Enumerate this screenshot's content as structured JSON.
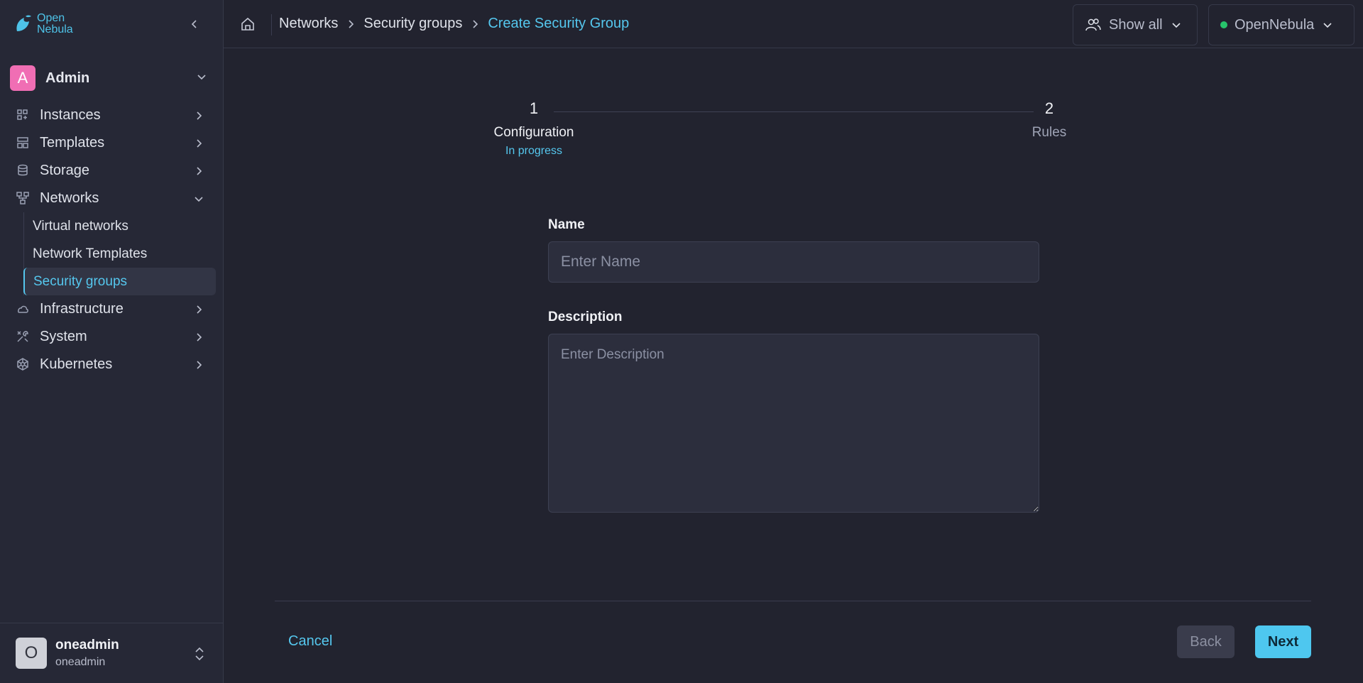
{
  "brand": {
    "logo_text_line1": "Open",
    "logo_text_line2": "Nebula",
    "accent": "#55c7ee"
  },
  "sidebar": {
    "group": {
      "avatar_letter": "A",
      "label": "Admin"
    },
    "items": [
      {
        "label": "Instances",
        "icon": "instances-icon"
      },
      {
        "label": "Templates",
        "icon": "templates-icon"
      },
      {
        "label": "Storage",
        "icon": "storage-icon"
      },
      {
        "label": "Networks",
        "icon": "networks-icon",
        "expanded": true,
        "children": [
          {
            "label": "Virtual networks"
          },
          {
            "label": "Network Templates"
          },
          {
            "label": "Security groups",
            "active": true
          }
        ]
      },
      {
        "label": "Infrastructure",
        "icon": "cloud-icon"
      },
      {
        "label": "System",
        "icon": "tools-icon"
      },
      {
        "label": "Kubernetes",
        "icon": "kubernetes-icon"
      }
    ],
    "user": {
      "avatar_letter": "O",
      "name": "oneadmin",
      "group": "oneadmin"
    }
  },
  "header": {
    "breadcrumb": [
      "Networks",
      "Security groups",
      "Create Security Group"
    ],
    "view_filter": "Show all",
    "zone": "OpenNebula",
    "zone_status_color": "#27c46b"
  },
  "stepper": {
    "steps": [
      {
        "number": "1",
        "label": "Configuration",
        "status": "In progress"
      },
      {
        "number": "2",
        "label": "Rules"
      }
    ]
  },
  "form": {
    "name_label": "Name",
    "name_placeholder": "Enter Name",
    "description_label": "Description",
    "description_placeholder": "Enter Description"
  },
  "actions": {
    "cancel": "Cancel",
    "back": "Back",
    "next": "Next"
  }
}
